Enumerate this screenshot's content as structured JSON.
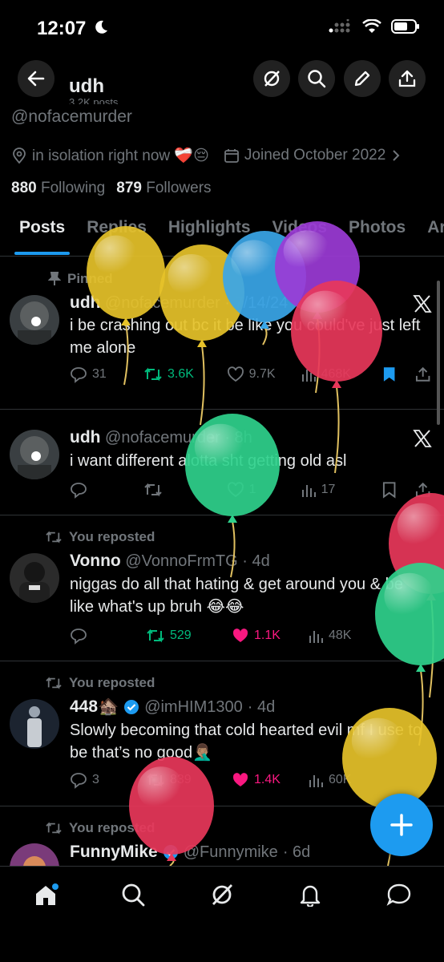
{
  "status_bar": {
    "time": "12:07"
  },
  "header": {
    "name": "udh",
    "post_count": "3.2K posts",
    "handle": "@nofacemurder"
  },
  "profile": {
    "location": "in isolation right now ❤️‍🩹😔",
    "joined": "Joined October 2022",
    "following_count": "880",
    "following_label": "Following",
    "followers_count": "879",
    "followers_label": "Followers"
  },
  "tabs": [
    "Posts",
    "Replies",
    "Highlights",
    "Videos",
    "Photos",
    "Art"
  ],
  "posts": [
    {
      "context": "Pinned",
      "name": "udh",
      "handle": "@nofacemurder",
      "date": "· 7/14/24",
      "text": "i be crashing out bc it be like you could've just left me alone",
      "replies": "31",
      "reposts": "3.6K",
      "likes": "9.7K",
      "views": "468K"
    },
    {
      "name": "udh",
      "handle": "@nofacemurder",
      "date": "· 8h",
      "text": "i want different alotta sht getting old asl",
      "replies": "",
      "reposts": "",
      "likes": "1",
      "views": "17"
    },
    {
      "context": "You reposted",
      "name": "Vonno",
      "handle": "@VonnoFrmTG",
      "date": "· 4d",
      "text": "niggas do all that hating & get around you & be like what's up bruh 😂😂",
      "replies": "",
      "reposts": "529",
      "likes": "1.1K",
      "views": "48K"
    },
    {
      "context": "You reposted",
      "name": "448🏚️",
      "handle": "@imHIM1300",
      "date": "· 4d",
      "text": "Slowly becoming that cold hearted evil mf I use to be that’s no good🤦🏽‍♂️",
      "replies": "3",
      "reposts": "839",
      "likes": "1.4K",
      "views": "60K"
    },
    {
      "context": "You reposted",
      "name": "FunnyMike",
      "handle": "@Funnymike",
      "date": "· 6d"
    }
  ],
  "colors": {
    "accent": "#1d9bf0",
    "repost_green": "#00ba7c",
    "like_pink": "#f91880"
  },
  "balloon_colors": [
    "#e6c229",
    "#e6c229",
    "#3aa6e8",
    "#9b3bd6",
    "#e8375a",
    "#2fd18c",
    "#e8375a",
    "#2fd18c",
    "#e6c229",
    "#e8375a"
  ]
}
